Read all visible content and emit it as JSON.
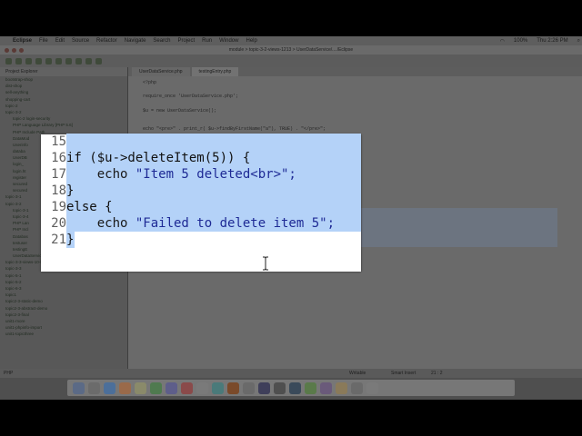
{
  "menubar": {
    "app": "Eclipse",
    "items": [
      "File",
      "Edit",
      "Source",
      "Refactor",
      "Navigate",
      "Search",
      "Project",
      "Run",
      "Window",
      "Help"
    ],
    "battery": "100%",
    "clock": "Thu 2:26 PM"
  },
  "window": {
    "title": "module > topic-3-2-views-1213 > UserDataService/..../Eclipse"
  },
  "explorer": {
    "title": "Project Explorer",
    "items": [
      "bootstrap-shop",
      "dist-shop",
      "sell-anything",
      "shopping-cart",
      "topic-2",
      "topic-3-2",
      "topic-2 login-security",
      "PHP Language Library [PHP 5.6]",
      "PHP Include Path",
      "DataMod",
      "Userinfo",
      "databa",
      "UserDB",
      "login_",
      "login.ht",
      "register",
      "secured",
      "secured",
      "topic-3-1",
      "topic-3-2",
      "topic-3-1",
      "topic-3-4",
      "PHP Lan",
      "PHP Incl",
      "Databas",
      "testuser",
      "testingE",
      "UserDataService.php",
      "topic-3-3-views-10-list",
      "topic-3-3",
      "topic-5-1",
      "topic-5-2",
      "topic-6-3",
      "topic1",
      "topic2-3-static-demo",
      "topic2-3-abstract-demo",
      "topic2-3-final",
      "unit1-more",
      "unit1-phpinfo-import",
      "unit1-topicthree"
    ]
  },
  "editor": {
    "tabs": [
      "UserDataService.php",
      "testingEntry.php"
    ],
    "lines": [
      "<?php",
      "",
      "require_once 'UserDataService.php';",
      "",
      "$u = new UserDataService();",
      "",
      "echo \"<pre>\" . print_r( $u->findByFirstName(\"a\"), TRUE) . \"</pre>\";"
    ]
  },
  "statusbar": {
    "left": "PHP",
    "mode": "Writable",
    "insert": "Smart Insert",
    "position": "21 : 2"
  },
  "zoom": {
    "lines": [
      {
        "num": "15",
        "text": "",
        "selected": true,
        "partial": true
      },
      {
        "num": "16",
        "text": "if ($u->deleteItem(5)) {",
        "selected": true
      },
      {
        "num": "17",
        "text": "    echo \"Item 5 deleted<br>\";",
        "selected": true
      },
      {
        "num": "18",
        "text": "}",
        "selected": true
      },
      {
        "num": "19",
        "text": "else {",
        "selected": true
      },
      {
        "num": "20",
        "text": "    echo \"Failed to delete item 5\";",
        "selected": true
      },
      {
        "num": "21",
        "text": "}",
        "selected": true,
        "partial": true
      }
    ]
  },
  "colors": {
    "selection": "#b4d2f8",
    "string": "#1e2a95",
    "dim_overlay": "#4f4f4f"
  }
}
